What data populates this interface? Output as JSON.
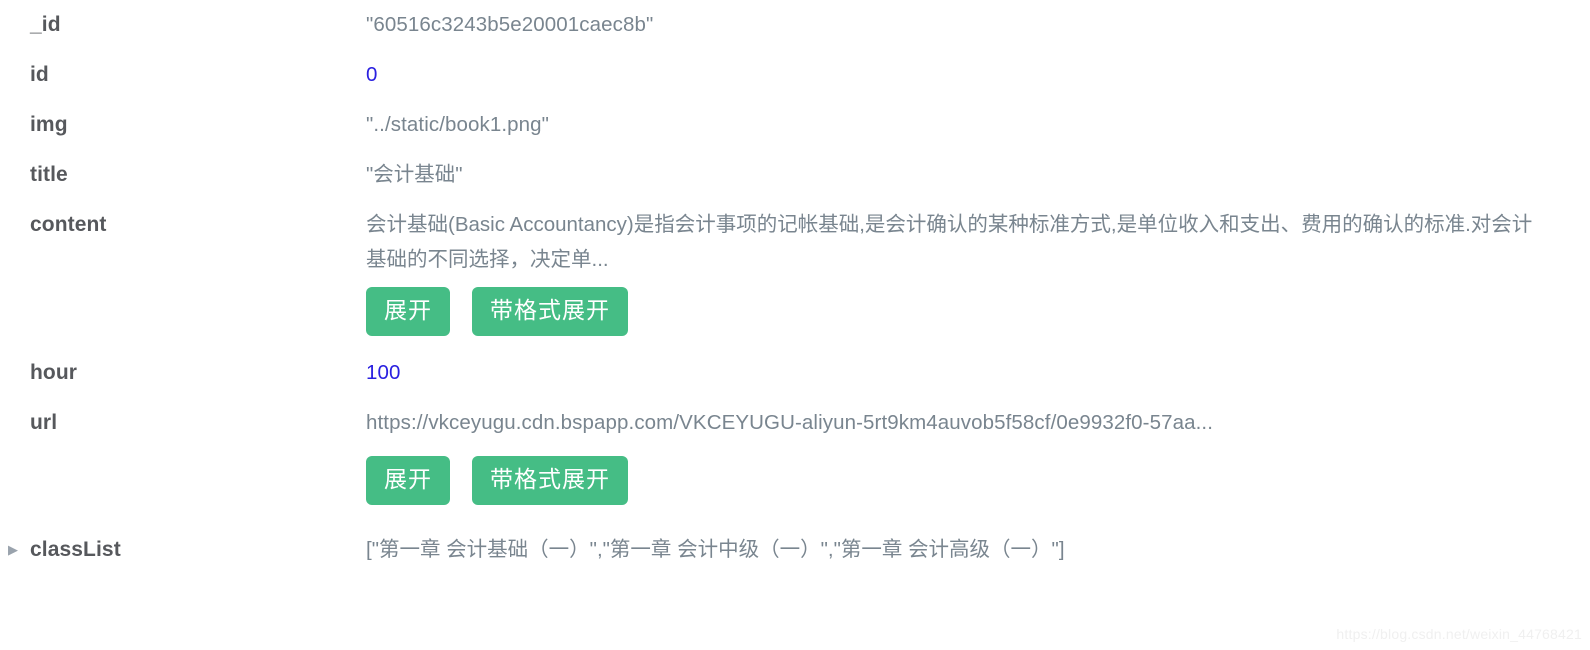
{
  "inspector": {
    "rows": [
      {
        "key": "_id",
        "value": "\"60516c3243b5e20001caec8b\"",
        "value_type": "string",
        "has_toggle": false,
        "buttons": []
      },
      {
        "key": "id",
        "value": "0",
        "value_type": "number",
        "has_toggle": false,
        "buttons": []
      },
      {
        "key": "img",
        "value": "\"../static/book1.png\"",
        "value_type": "string",
        "has_toggle": false,
        "buttons": []
      },
      {
        "key": "title",
        "value": "\"会计基础\"",
        "value_type": "string",
        "has_toggle": false,
        "buttons": []
      },
      {
        "key": "content",
        "value": "会计基础(Basic Accountancy)是指会计事项的记帐基础,是会计确认的某种标准方式,是单位收入和支出、费用的确认的标准.对会计基础的不同选择，决定单...",
        "value_type": "string-wrapped",
        "has_toggle": false,
        "buttons": [
          {
            "label": "展开",
            "name": "expand-button"
          },
          {
            "label": "带格式展开",
            "name": "expand-formatted-button"
          }
        ]
      },
      {
        "key": "hour",
        "value": "100",
        "value_type": "number",
        "has_toggle": false,
        "buttons": []
      },
      {
        "key": "url",
        "value": "https://vkceyugu.cdn.bspapp.com/VKCEYUGU-aliyun-5rt9km4auvob5f58cf/0e9932f0-57aa...",
        "value_type": "string",
        "has_toggle": false,
        "buttons": [
          {
            "label": "展开",
            "name": "expand-button"
          },
          {
            "label": "带格式展开",
            "name": "expand-formatted-button"
          }
        ]
      },
      {
        "key": "classList",
        "value": "[\"第一章 会计基础（一）\",\"第一章 会计中级（一）\",\"第一章 会计高级（一）\"]",
        "value_type": "array",
        "has_toggle": true,
        "toggle_glyph": "▶",
        "buttons": []
      }
    ]
  },
  "watermark": {
    "text": "https://blog.csdn.net/weixin_44768421"
  },
  "colors": {
    "key_text": "#56585c",
    "value_text": "#79858f",
    "number_value": "#2a20e0",
    "button_bg": "#45bd85",
    "button_text": "#ffffff",
    "background": "#ffffff",
    "toggle_arrow": "#9aa3ad"
  }
}
